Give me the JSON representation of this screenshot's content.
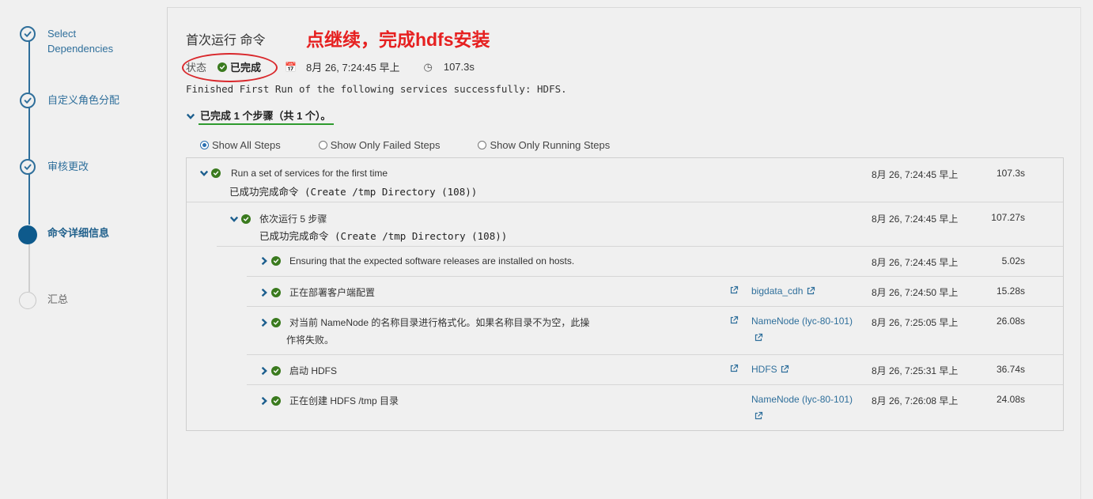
{
  "wizard": {
    "steps": [
      {
        "label_line1": "Select",
        "label_line2": "Dependencies",
        "state": "done"
      },
      {
        "label_line1": "自定义角色分配",
        "state": "done"
      },
      {
        "label_line1": "审核更改",
        "state": "done"
      },
      {
        "label_line1": "命令详细信息",
        "state": "current"
      },
      {
        "label_line1": "汇总",
        "state": "todo"
      }
    ]
  },
  "command": {
    "title": "首次运行 命令",
    "annotation": "点继续，完成hdfs安装",
    "status_label": "状态",
    "status_value": "已完成",
    "timestamp": "8月 26, 7:24:45 早上",
    "duration": "107.3s",
    "message": "Finished First Run of the following services successfully: HDFS.",
    "steps_summary": "已完成 1 个步骤（共 1 个）。"
  },
  "filters": {
    "all": "Show All Steps",
    "failed": "Show Only Failed Steps",
    "running": "Show Only Running Steps",
    "selected": "all"
  },
  "rows": [
    {
      "title": "Run a set of services for the first time",
      "subtitle": "已成功完成命令 (Create /tmp Directory (108))",
      "time": "8月 26, 7:24:45 早上",
      "duration": "107.3s"
    },
    {
      "title": "依次运行 5 步骤",
      "subtitle": "已成功完成命令 (Create /tmp Directory (108))",
      "time": "8月 26, 7:24:45 早上",
      "duration": "107.27s"
    },
    {
      "title": "Ensuring that the expected software releases are installed on hosts.",
      "time": "8月 26, 7:24:45 早上",
      "duration": "5.02s"
    },
    {
      "title": "正在部署客户端配置",
      "target": "bigdata_cdh",
      "time": "8月 26, 7:24:50 早上",
      "duration": "15.28s"
    },
    {
      "title_line1": "对当前 NameNode 的名称目录进行格式化。如果名称目录不为空，此操",
      "title_line2": "作将失败。",
      "target": "NameNode (lyc-80-101)",
      "time": "8月 26, 7:25:05 早上",
      "duration": "26.08s"
    },
    {
      "title": "启动 HDFS",
      "target": "HDFS",
      "time": "8月 26, 7:25:31 早上",
      "duration": "36.74s"
    },
    {
      "title": "正在创建 HDFS /tmp 目录",
      "target": "NameNode (lyc-80-101)",
      "time": "8月 26, 7:26:08 早上",
      "duration": "24.08s"
    }
  ],
  "colors": {
    "accent": "#2f6f9b",
    "success": "#3a7a1e",
    "annotation": "#e62020"
  }
}
